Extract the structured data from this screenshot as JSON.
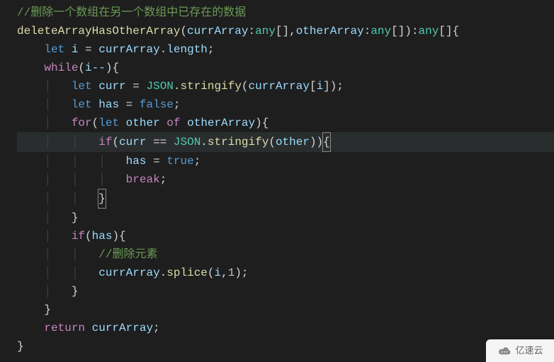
{
  "code": {
    "l1_comment": "//删除一个数组在另一个数组中已存在的数据",
    "l2_fn": "deleteArrayHasOtherArray",
    "l2_p1": "currArray",
    "l2_p2": "otherArray",
    "l2_type": "any",
    "l3_let": "let",
    "l3_var": "i",
    "l3_expr_obj": "currArray",
    "l3_expr_prop": "length",
    "l4_while": "while",
    "l4_cond": "i--",
    "l5_let": "let",
    "l5_var": "curr",
    "l5_json": "JSON",
    "l5_strfy": "stringify",
    "l5_arg": "currArray",
    "l5_idx": "i",
    "l6_let": "let",
    "l6_var": "has",
    "l6_val": "false",
    "l7_for": "for",
    "l7_let": "let",
    "l7_var": "other",
    "l7_of": "of",
    "l7_arr": "otherArray",
    "l8_if": "if",
    "l8_lhs": "curr",
    "l8_eq": "==",
    "l8_json": "JSON",
    "l8_strfy": "stringify",
    "l8_arg": "other",
    "l9_var": "has",
    "l9_val": "true",
    "l10_break": "break",
    "l13_if": "if",
    "l13_cond": "has",
    "l14_comment": "//删除元素",
    "l15_obj": "currArray",
    "l15_method": "splice",
    "l15_a1": "i",
    "l15_a2": "1",
    "l18_return": "return",
    "l18_var": "currArray"
  },
  "watermark": {
    "text": "亿速云"
  }
}
